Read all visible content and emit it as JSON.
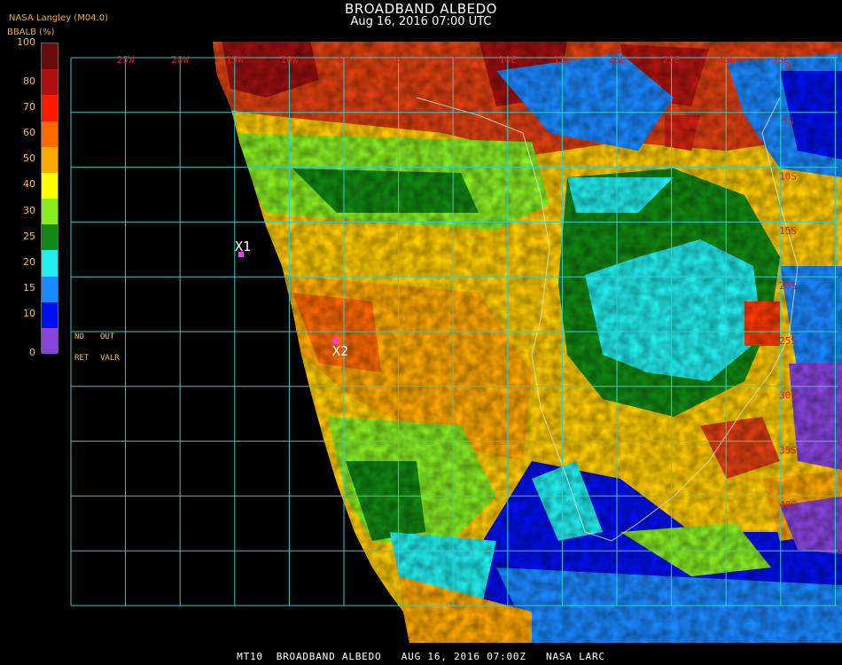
{
  "header": {
    "title": "BROADBAND ALBEDO",
    "subtitle": "Aug 16, 2016 07:00 UTC"
  },
  "source_label": "NASA Langley (M04.0)",
  "colorbar": {
    "unit_label": "BBALB (%)",
    "ticks": [
      "100",
      "80",
      "70",
      "60",
      "50",
      "40",
      "30",
      "25",
      "20",
      "15",
      "10",
      "0"
    ],
    "colors": [
      "#6b0c0c",
      "#b01010",
      "#ff1a00",
      "#ff6a00",
      "#ffaa00",
      "#ffff00",
      "#88ee22",
      "#118811",
      "#22eeee",
      "#1a88ff",
      "#0010ee",
      "#8844dd"
    ]
  },
  "legend_labels": {
    "no": "NO",
    "out": "OUT",
    "ret": "RET",
    "valr": "VALR"
  },
  "grid": {
    "longitude_labels": [
      "25W",
      "20W",
      "15W",
      "10W",
      "5W",
      "0",
      "5E",
      "10E",
      "15E",
      "20E",
      "25E",
      "30E",
      "35E"
    ],
    "latitude_labels": [
      "0",
      "5S",
      "10S",
      "15S",
      "20S",
      "25S",
      "30S",
      "35S",
      "40S"
    ],
    "line_color": "#33cccc",
    "label_color": "#cc2222"
  },
  "markers": [
    {
      "label": "X1",
      "color": "#ff33ff"
    },
    {
      "label": "X2",
      "color": "#ff33ff"
    }
  ],
  "footer": "MT10  BROADBAND ALBEDO   AUG 16, 2016 07:00Z   NASA LARC"
}
